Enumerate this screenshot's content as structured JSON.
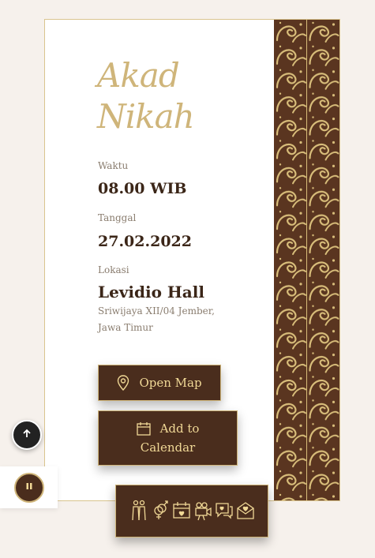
{
  "event": {
    "title_line1": "Akad",
    "title_line2": "Nikah",
    "time_label": "Waktu",
    "time_value": "08.00 WIB",
    "date_label": "Tanggal",
    "date_value": "27.02.2022",
    "location_label": "Lokasi",
    "venue": "Levidio Hall",
    "address": "Sriwijaya XII/04 Jember, Jawa Timur"
  },
  "buttons": {
    "open_map": "Open Map",
    "add_calendar_line1": "Add to",
    "add_calendar_line2": "Calendar"
  },
  "nav": {
    "items": [
      {
        "icon": "couple-icon"
      },
      {
        "icon": "gender-rings-icon"
      },
      {
        "icon": "calendar-heart-icon"
      },
      {
        "icon": "video-camera-icon"
      },
      {
        "icon": "chat-bubble-icon"
      },
      {
        "icon": "love-letter-icon"
      }
    ]
  },
  "colors": {
    "brown": "#4a2d1d",
    "gold": "#cfb57a",
    "gold_text": "#f0d896",
    "page_background": "#f6f1ec",
    "dark_text": "#3b2618"
  }
}
